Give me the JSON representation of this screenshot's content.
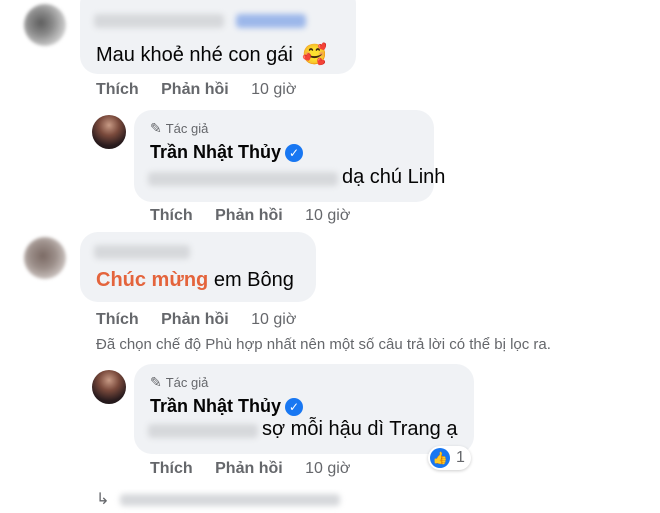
{
  "comments": [
    {
      "text": "Mau khoẻ nhé con gái",
      "emoji": "🥰",
      "like": "Thích",
      "reply": "Phản hồi",
      "time": "10 giờ",
      "reply_comment": {
        "author_badge": "Tác giả",
        "author": "Trần Nhật Thủy",
        "text": "dạ chú Linh",
        "like": "Thích",
        "reply": "Phản hồi",
        "time": "10 giờ"
      }
    },
    {
      "highlight": "Chúc mừng",
      "text": "em Bông",
      "like": "Thích",
      "reply": "Phản hồi",
      "time": "10 giờ",
      "filter_note": "Đã chọn chế độ Phù hợp nhất nên một số câu trả lời có thể bị lọc ra.",
      "reply_comment": {
        "author_badge": "Tác giả",
        "author": "Trần Nhật Thủy",
        "text": "sợ mỗi hậu dì Trang ạ",
        "like": "Thích",
        "reply": "Phản hồi",
        "time": "10 giờ",
        "reaction_count": "1"
      }
    }
  ],
  "colors": {
    "highlight": "#e4643c",
    "verified": "#1877f2",
    "bubble": "#f0f2f5",
    "meta": "#65676b"
  },
  "icons": [
    "pencil-icon",
    "verified-icon",
    "like-reaction-icon",
    "reply-arrow-icon"
  ]
}
